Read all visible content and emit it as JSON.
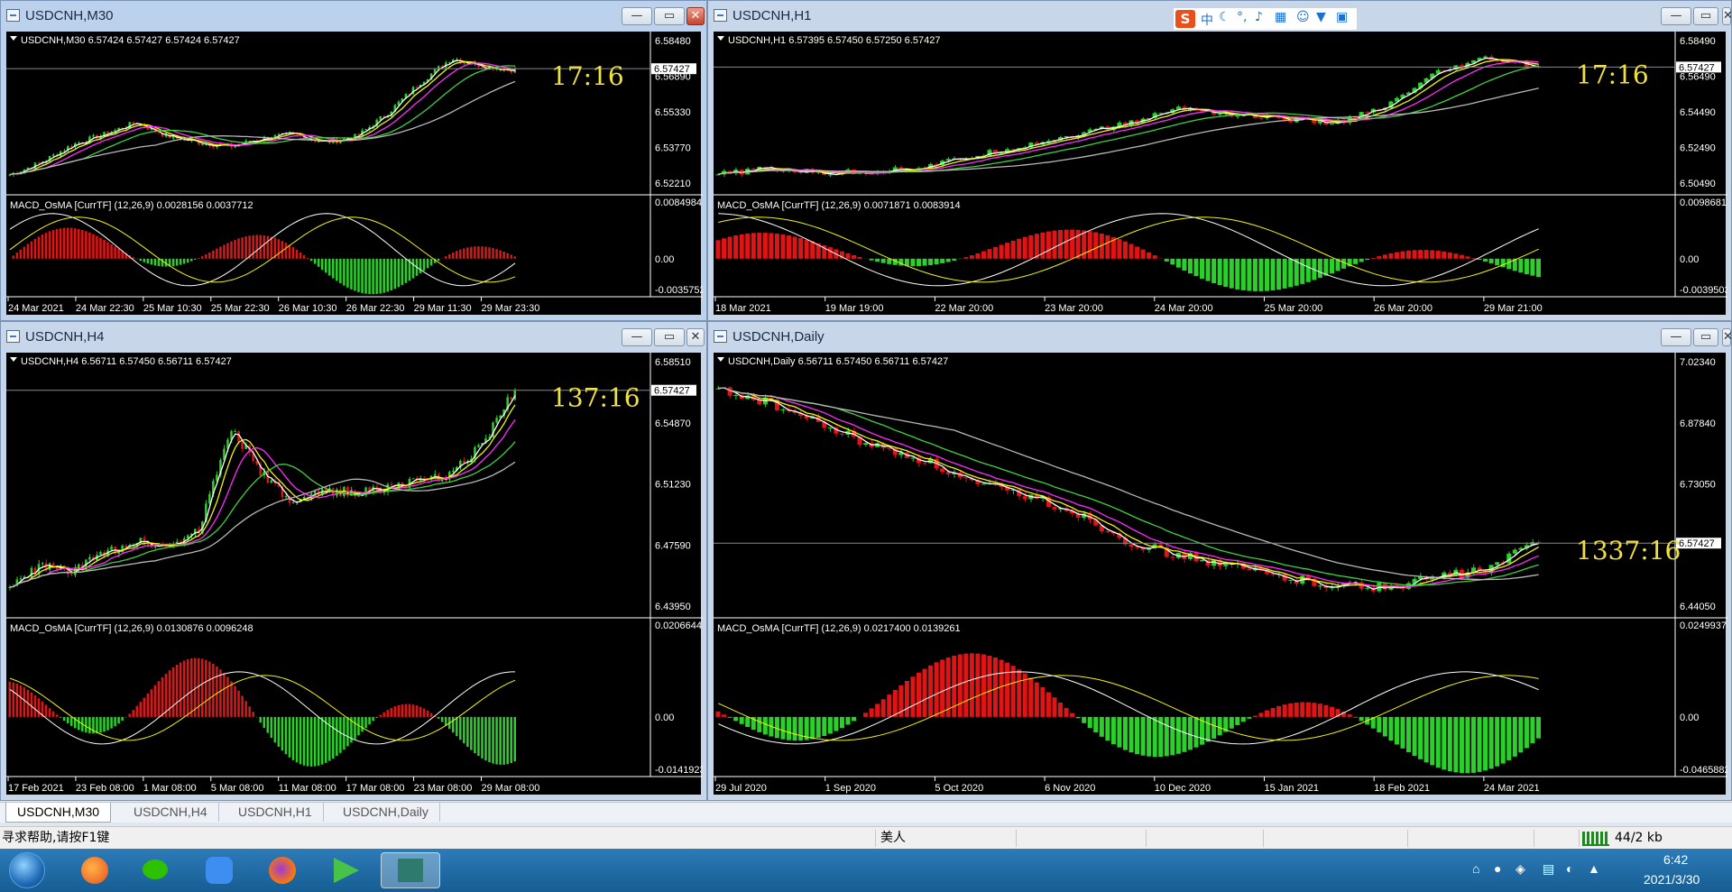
{
  "windows": [
    {
      "id": "w1",
      "title": "USDCNH,M30",
      "ohlc": "USDCNH,M30  6.57424 6.57427 6.57424 6.57427",
      "price": "6.57427",
      "timer": "17:16",
      "yticks": [
        "6.58480",
        "6.56890",
        "6.55330",
        "6.53770",
        "6.52210"
      ],
      "macd_label": "MACD_OsMA [CurrTF] (12,26,9) 0.0028156 0.0037712",
      "macd_ticks": [
        "0.0084984",
        "0.00",
        "-0.0035752"
      ],
      "xticks": [
        "24 Mar 2021",
        "24 Mar 22:30",
        "25 Mar 10:30",
        "25 Mar 22:30",
        "26 Mar 10:30",
        "26 Mar 22:30",
        "29 Mar 11:30",
        "29 Mar 23:30"
      ],
      "series": {
        "type": "candlestick",
        "trend": [
          6.522,
          6.528,
          6.537,
          6.542,
          6.548,
          6.541,
          6.538,
          6.536,
          6.54,
          6.542,
          6.538,
          6.541,
          6.553,
          6.568,
          6.58,
          6.576,
          6.574
        ]
      }
    },
    {
      "id": "w2",
      "title": "USDCNH,H1",
      "ohlc": "USDCNH,H1  6.57395 6.57450 6.57250 6.57427",
      "price": "6.57427",
      "timer": "17:16",
      "yticks": [
        "6.58490",
        "6.56490",
        "6.54490",
        "6.52490",
        "6.50490"
      ],
      "macd_label": "MACD_OsMA [CurrTF] (12,26,9) 0.0071871 0.0083914",
      "macd_ticks": [
        "0.0098681",
        "0.00",
        "-0.0039503"
      ],
      "xticks": [
        "18 Mar 2021",
        "19 Mar 19:00",
        "22 Mar 20:00",
        "23 Mar 20:00",
        "24 Mar 20:00",
        "25 Mar 20:00",
        "26 Mar 20:00",
        "29 Mar 21:00"
      ],
      "series": {
        "type": "candlestick",
        "trend": [
          6.505,
          6.509,
          6.506,
          6.507,
          6.51,
          6.517,
          6.524,
          6.531,
          6.538,
          6.548,
          6.544,
          6.541,
          6.538,
          6.548,
          6.57,
          6.58,
          6.574
        ]
      }
    },
    {
      "id": "w3",
      "title": "USDCNH,H4",
      "ohlc": "USDCNH,H4  6.56711 6.57450 6.56711 6.57427",
      "price": "6.57427",
      "timer": "137:16",
      "yticks": [
        "6.58510",
        "6.54870",
        "6.51230",
        "6.47590",
        "6.43950"
      ],
      "macd_label": "MACD_OsMA [CurrTF] (12,26,9) 0.0130876 0.0096248",
      "macd_ticks": [
        "0.0206644",
        "0.00",
        "-0.0141923"
      ],
      "xticks": [
        "17 Feb 2021",
        "23 Feb 08:00",
        "1 Mar 08:00",
        "5 Mar 08:00",
        "11 Mar 08:00",
        "17 Mar 08:00",
        "23 Mar 08:00",
        "29 Mar 08:00"
      ],
      "series": {
        "type": "candlestick",
        "trend": [
          6.448,
          6.462,
          6.458,
          6.47,
          6.478,
          6.474,
          6.485,
          6.55,
          6.52,
          6.5,
          6.51,
          6.508,
          6.512,
          6.515,
          6.52,
          6.54,
          6.574
        ]
      }
    },
    {
      "id": "w4",
      "title": "USDCNH,Daily",
      "ohlc": "USDCNH,Daily  6.56711 6.57450 6.56711 6.57427",
      "price": "6.57427",
      "timer": "1337:16",
      "yticks": [
        "7.02340",
        "6.87840",
        "6.73050",
        "6.57427",
        "6.44050"
      ],
      "macd_label": "MACD_OsMA [CurrTF] (12,26,9) 0.0217400 0.0139261",
      "macd_ticks": [
        "0.0249937",
        "0.00",
        "-0.0465882"
      ],
      "xticks": [
        "29 Jul 2020",
        "1 Sep 2020",
        "5 Oct 2020",
        "6 Nov 2020",
        "10 Dec 2020",
        "15 Jan 2021",
        "18 Feb 2021",
        "24 Mar 2021"
      ],
      "series": {
        "type": "candlestick",
        "trend": [
          7.0,
          6.96,
          6.9,
          6.84,
          6.8,
          6.73,
          6.7,
          6.65,
          6.57,
          6.53,
          6.5,
          6.47,
          6.45,
          6.44,
          6.47,
          6.49,
          6.574
        ]
      }
    }
  ],
  "tabs": [
    "USDCNH,M30",
    "USDCNH,H4",
    "USDCNH,H1",
    "USDCNH,Daily"
  ],
  "status": {
    "help": "寻求帮助,请按F1键",
    "profile": "美人",
    "traffic": "44/2 kb"
  },
  "ime": {
    "chars": [
      "中"
    ]
  },
  "clock": {
    "time": "6:42",
    "date": "2021/3/30"
  },
  "colors": {
    "bull": "#2bd02b",
    "bear": "#e01414",
    "ma_fast": "#ffffff",
    "ma_yellow": "#f4f40a",
    "ma_magenta": "#ff2bff",
    "ma_green": "#40d040",
    "ma_gray": "#b8b8b8",
    "timer": "#f0e040"
  }
}
